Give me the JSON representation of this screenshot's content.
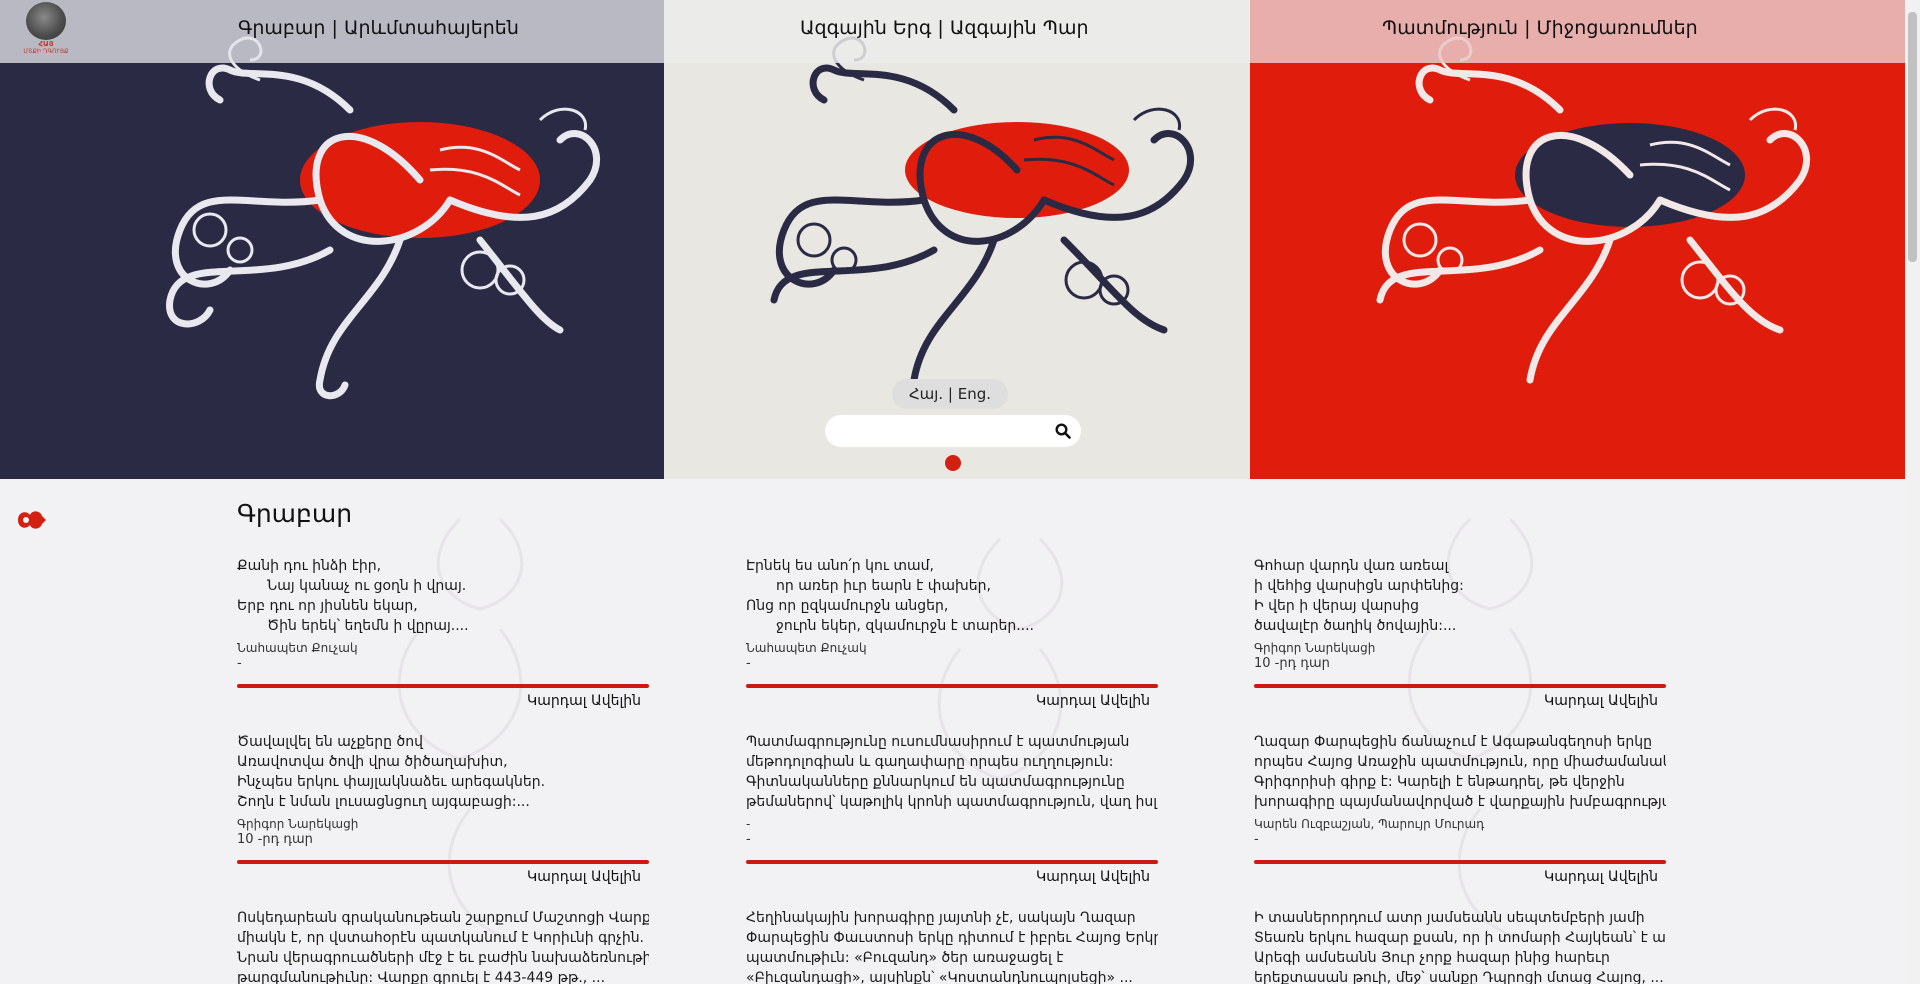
{
  "header": {
    "logo_line1": "ՀԱՅ",
    "logo_line2": "ՄՏՔԻ ԴԳՈՒՅՔ",
    "nav": [
      "Գրաբար | Արևմտահայերեն",
      "Ազգային Երգ | Ազգային Պար",
      "Պատմություն | Միջոցառումներ"
    ]
  },
  "hero": {
    "lang_arm": "Հայ.",
    "lang_sep": "|",
    "lang_eng": "Eng.",
    "search_placeholder": "",
    "icons": {
      "search": "search-icon",
      "slider_dot": "slider-dot"
    },
    "colors": {
      "dark": "#2a2a45",
      "light": "#e8e7e2",
      "red": "#e01d0c"
    }
  },
  "section": {
    "title": "Գրաբար",
    "read_more": "Կարդալ Ավելին",
    "cards": [
      {
        "lines": [
          "Քանի դու ինձի էիր,",
          "Նայ կանաչ ու ցօղն ի վրայ.",
          "Երբ դու որ յիսնեն եկար,",
          "Ծին երեկ՝ եղեմն ի վըրայ...."
        ],
        "indent": [
          false,
          true,
          false,
          true
        ],
        "author": "Նահապետ Քուչակ",
        "century": "-"
      },
      {
        "lines": [
          "Էրնեկ ես անո՛ր կու տամ,",
          "որ առեր իւր եարն է փախեր,",
          "Ոնց որ ըզկամուրջն անցեր,",
          "ջուրն եկեր, զկամուրջն է տարեր...."
        ],
        "indent": [
          false,
          true,
          false,
          true
        ],
        "author": "Նահապետ Քուչակ",
        "century": "-"
      },
      {
        "lines": [
          "Գոհար վարդն վառ առեալ",
          "ի վեհից վարսիցն արփենից:",
          "Ի վեր ի վերայ վարսից",
          "ծավալէր ծաղիկ ծովային:..."
        ],
        "indent": [
          false,
          false,
          false,
          false
        ],
        "author": "Գրիգոր Նարեկացի",
        "century": "10 -րդ դար"
      },
      {
        "lines": [
          "Ծավալվել են աչքերը ծով",
          "Առավոտվա ծովի վրա ծիծաղախիտ,",
          "Ինչպես երկու փայլակնաձեւ արեգակներ.",
          "Շողն է նման լուսացնցուղ այգաբացի:..."
        ],
        "indent": [
          false,
          false,
          false,
          false
        ],
        "author": "Գրիգոր Նարեկացի",
        "century": "10 -րդ դար"
      },
      {
        "lines": [
          "Պատմագրությունը ուսումնասիրում է պատմության",
          "մեթոդոլոգիան և գաղափարը որպես ուղղություն:",
          "Գիտնականները քննարկում են պատմագրությունը",
          "թեմաներով՝ կաթոլիկ կրոնի պատմագրություն, վաղ իսլամ..."
        ],
        "indent": [
          false,
          false,
          false,
          false
        ],
        "author": "-",
        "century": "-"
      },
      {
        "lines": [
          "Ղազար Փարպեցին ճանաչում է Ագաթանգեղոսի երկը",
          "որպես Հայոց Առաջին պատմություն, որը միաժամանակ",
          "Գրիգորիսի գիրք է: Կարելի է ենթադրել, թե վերջին",
          "խորագիրը պայմանավորված է վարքային խմբագրությա..."
        ],
        "indent": [
          false,
          false,
          false,
          false
        ],
        "author": "Կարեն Ուզբաշյան, Պարույր Մուրադ",
        "century": "-"
      },
      {
        "lines": [
          "Ոսկեդարեան գրականութեան շարքում Մաշտոցի Վարքը",
          "միակն է, որ վստահօրէն պատկանում է Կորիւնի գրչին.",
          "Նրան վերագրուածների մէջ է եւ բաժին նախաձեռնութիւնների",
          "թարգմանութիւնը: Վարքը գրուել է 443-449 թթ., ..."
        ],
        "indent": [
          false,
          false,
          false,
          false
        ],
        "author": "",
        "century": ""
      },
      {
        "lines": [
          "Հեղինակային խորագիրը յայտնի չէ, սակայն Ղազար",
          "Փարպեցին Փաւստոսի երկը դիտում է իբրեւ Հայոց Երկրորդ",
          "պատմութիւն: «Բուզանդ» ծեր առաջացել է",
          "«Բիւզանդացի», այսինքն՝ «Կոստանդնուպոլսեցի» ..."
        ],
        "indent": [
          false,
          false,
          false,
          false
        ],
        "author": "",
        "century": ""
      },
      {
        "lines": [
          "Ի տասներորդում ատր յամսեանն սեպտեմբերի յամի",
          "Տեառն երկու հազար քսան, որ ի տոմարի Հայկեան՝ է ար",
          "Արեգի ամսեանն Յուր չորք հազար ինից հարեւր",
          "երեքտասան թուի, մեջ՝ սանքը Դպրոցի մտաց Հայոց, ..."
        ],
        "indent": [
          false,
          false,
          false,
          false
        ],
        "author": "",
        "century": ""
      }
    ]
  }
}
